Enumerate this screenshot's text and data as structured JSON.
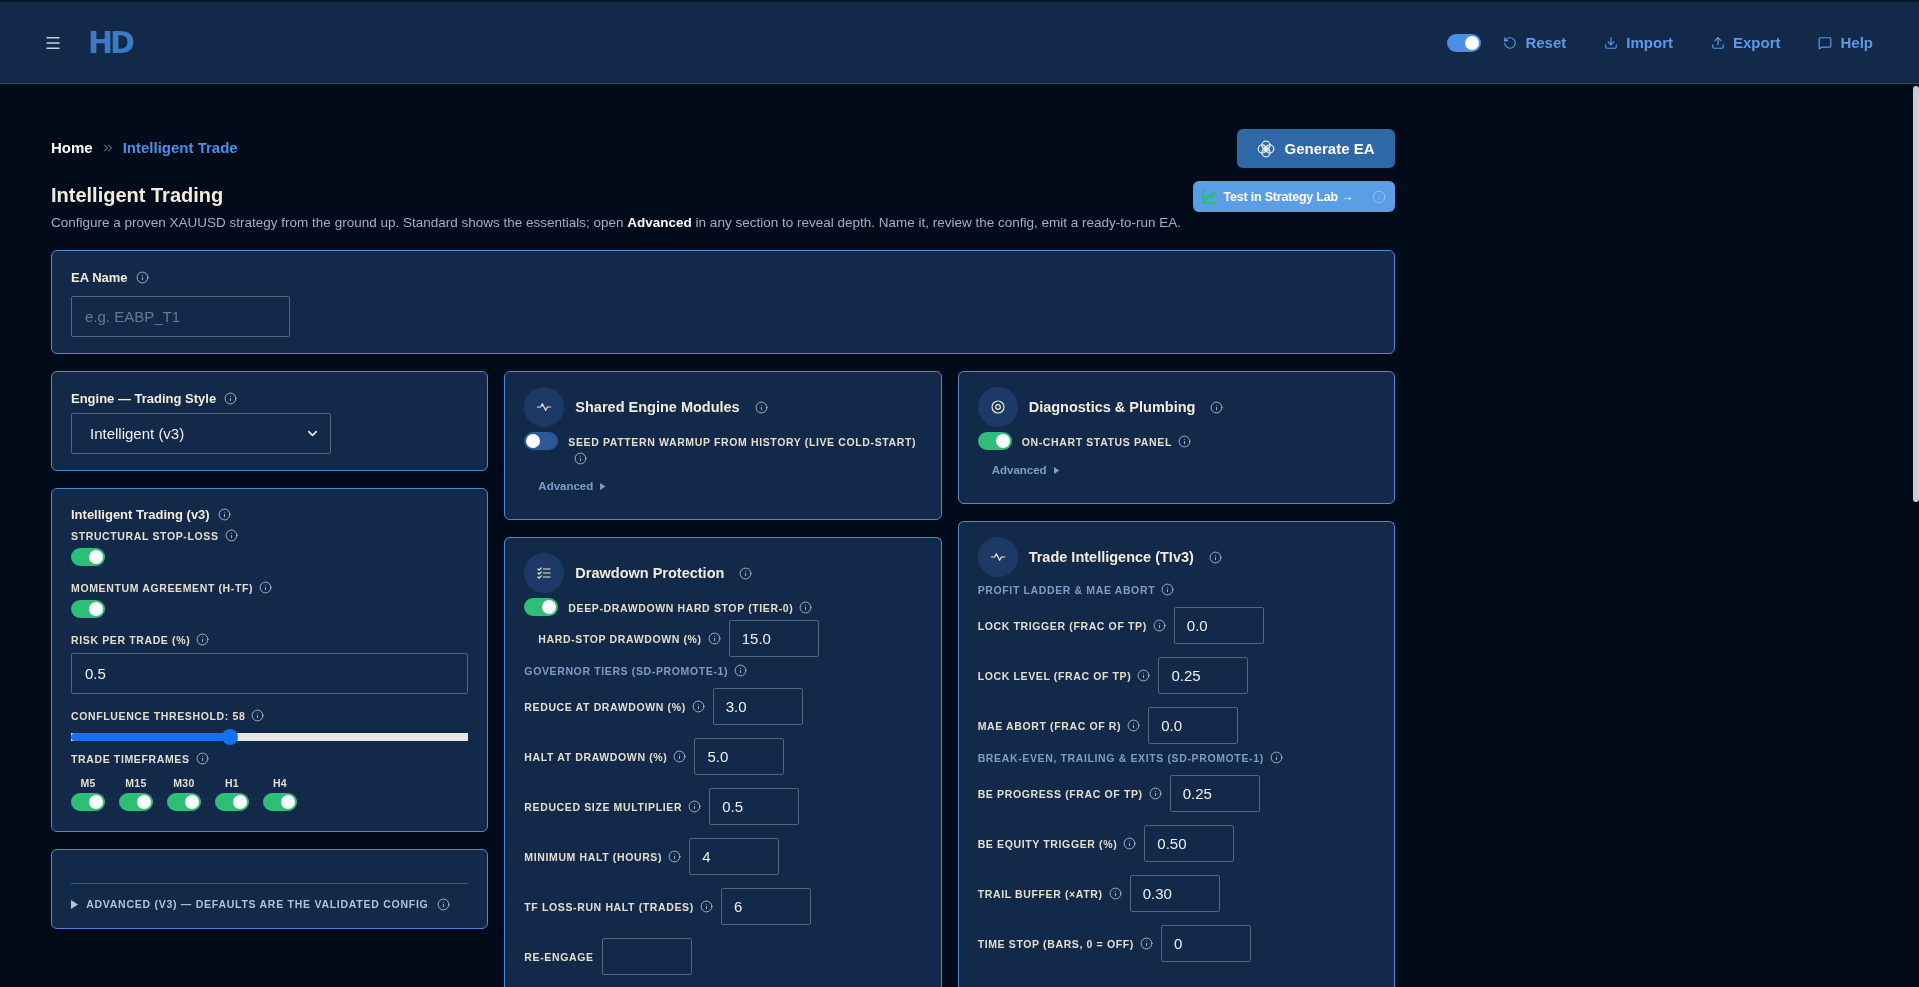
{
  "header": {
    "logo": "HD",
    "theme_toggle": {
      "on": true
    },
    "actions": [
      {
        "kind": "reset",
        "label": "Reset"
      },
      {
        "kind": "import",
        "label": "Import"
      },
      {
        "kind": "export",
        "label": "Export"
      },
      {
        "kind": "help",
        "label": "Help"
      }
    ]
  },
  "breadcrumb": [
    {
      "label": "Home",
      "current": false
    },
    {
      "label": "Intelligent Trade",
      "current": true
    }
  ],
  "page": {
    "title": "Intelligent Trading",
    "description": "Configure a proven XAUUSD strategy from the ground up. Standard shows the essentials; open **Advanced** in any section to reveal depth. Name it, review the config, emit a ready-to-run EA.",
    "generate_button": "Generate EA",
    "strategy_lab_button": "Test in Strategy Lab →"
  },
  "ea_name": {
    "label": "EA Name",
    "placeholder": "e.g. EABP_T1"
  },
  "columns": [
    {
      "cards": [
        {
          "kind": "select",
          "title": "Engine — Trading Style",
          "value": "Intelligent (v3)"
        },
        {
          "kind": "form",
          "title": "Intelligent Trading (v3)",
          "items": [
            {
              "kind": "toggle",
              "label": "STRUCTURAL STOP-LOSS",
              "on": true
            },
            {
              "kind": "toggle",
              "label": "MOMENTUM AGREEMENT (H-TF)",
              "on": true
            },
            {
              "kind": "input",
              "label": "RISK PER TRADE (%)",
              "value": "0.5"
            },
            {
              "kind": "slider",
              "label": "CONFLUENCE THRESHOLD: 58",
              "level": 0.4
            },
            {
              "kind": "toggle_group",
              "label": "TRADE TIMEFRAMES",
              "toggles": [
                {
                  "label": "M5",
                  "on": true
                },
                {
                  "label": "M15",
                  "on": true
                },
                {
                  "label": "M30",
                  "on": true
                },
                {
                  "label": "H1",
                  "on": true
                },
                {
                  "label": "H4",
                  "on": true
                }
              ]
            }
          ]
        },
        {
          "kind": "disclosure",
          "label": "ADVANCED (V3) — DEFAULTS ARE THE VALIDATED CONFIG",
          "expanded": false
        }
      ]
    },
    {
      "cards": [
        {
          "kind": "module",
          "title": "Shared Engine Modules",
          "items": [
            {
              "kind": "toggle",
              "label": "SEED PATTERN WARMUP FROM HISTORY (LIVE COLD-START)",
              "on": false
            }
          ],
          "advanced": {
            "label": "Advanced",
            "expanded": false
          }
        },
        {
          "kind": "module",
          "title": "Drawdown Protection",
          "continues_below": true,
          "items": [
            {
              "kind": "toggle",
              "label": "DEEP-DRAWDOWN HARD STOP (TIER-0)",
              "on": true,
              "children": [
                {
                  "kind": "input",
                  "label": "HARD-STOP DRAWDOWN (%)",
                  "value": "15.0"
                }
              ]
            },
            {
              "kind": "heading",
              "label": "GOVERNOR TIERS (SD-PROMOTE-1)"
            },
            {
              "kind": "input",
              "label": "REDUCE AT DRAWDOWN (%)",
              "value": "3.0"
            },
            {
              "kind": "input",
              "label": "HALT AT DRAWDOWN (%)",
              "value": "5.0"
            },
            {
              "kind": "input",
              "label": "REDUCED SIZE MULTIPLIER",
              "value": "0.5"
            },
            {
              "kind": "input",
              "label": "MINIMUM HALT (HOURS)",
              "value": "4"
            },
            {
              "kind": "input",
              "label": "TF LOSS-RUN HALT (TRADES)",
              "value": "6"
            },
            {
              "kind": "input",
              "label": "RE-ENGAGE",
              "info": false
            }
          ]
        }
      ]
    },
    {
      "cards": [
        {
          "kind": "module",
          "title": "Diagnostics & Plumbing",
          "items": [
            {
              "kind": "toggle",
              "label": "ON-CHART STATUS PANEL",
              "on": true
            }
          ],
          "advanced": {
            "label": "Advanced",
            "expanded": false
          }
        },
        {
          "kind": "module",
          "title": "Trade Intelligence (TIv3)",
          "continues_below": true,
          "items": [
            {
              "kind": "heading",
              "label": "PROFIT LADDER & MAE ABORT"
            },
            {
              "kind": "input",
              "label": "LOCK TRIGGER (FRAC OF TP)",
              "value": "0.0"
            },
            {
              "kind": "input",
              "label": "LOCK LEVEL (FRAC OF TP)",
              "value": "0.25"
            },
            {
              "kind": "input",
              "label": "MAE ABORT (FRAC OF R)",
              "value": "0.0"
            },
            {
              "kind": "heading",
              "label": "BREAK-EVEN, TRAILING & EXITS (SD-PROMOTE-1)"
            },
            {
              "kind": "input",
              "label": "BE PROGRESS (FRAC OF TP)",
              "value": "0.25"
            },
            {
              "kind": "input",
              "label": "BE EQUITY TRIGGER (%)",
              "value": "0.50"
            },
            {
              "kind": "input",
              "label": "TRAIL BUFFER (×ATR)",
              "value": "0.30"
            },
            {
              "kind": "input",
              "label": "TIME STOP (BARS, 0 = OFF)",
              "value": "0"
            }
          ]
        }
      ]
    }
  ]
}
